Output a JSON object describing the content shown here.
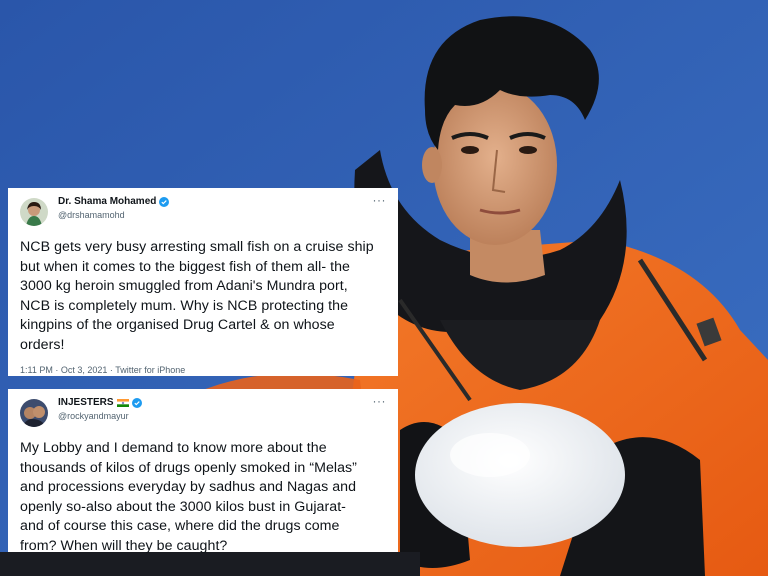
{
  "tweets": [
    {
      "author": "Dr. Shama Mohamed",
      "handle": "@drshamamohd",
      "more": "···",
      "lines": [
        "NCB gets very busy arresting small fish on a cruise ship",
        "but when it comes to the biggest fish of them all- the",
        "3000 kg heroin smuggled from Adani's Mundra port,",
        "NCB is completely mum. Why is NCB protecting the",
        "kingpins of the organised Drug Cartel & on whose",
        "orders!"
      ],
      "meta": "1:11 PM · Oct 3, 2021 · Twitter for iPhone"
    },
    {
      "author": "INJESTERS",
      "handle": "@rockyandmayur",
      "more": "···",
      "lines": [
        "My Lobby and I demand to know more about the",
        "thousands of kilos of drugs openly smoked in “Melas”",
        "and processions everyday by sadhus and Nagas and",
        "openly so-also about the 3000 kilos bust in Gujarat-",
        "and of course this case, where did the drugs come",
        "from? When will they be caught?"
      ]
    }
  ],
  "colors": {
    "sky": "#2f5fb4",
    "jacket": "#f06a1e",
    "verified": "#1d9bf0",
    "meta_text": "#536471"
  },
  "icons": [
    "verified-badge-icon",
    "india-flag-icon",
    "more-options-icon"
  ]
}
